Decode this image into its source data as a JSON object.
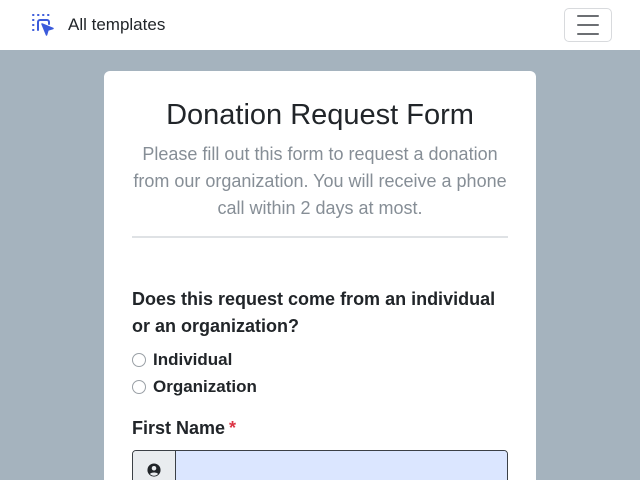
{
  "navbar": {
    "brand_label": "All templates",
    "brand_icon": "cursor-select-icon",
    "menu_icon": "hamburger-menu-icon"
  },
  "form": {
    "title": "Donation Request Form",
    "description": "Please fill out this form to request a donation from our organization. You will receive a phone call within 2 days at most.",
    "question": "Does this request come from an individual or an organization?",
    "options": [
      {
        "label": "Individual",
        "checked": false
      },
      {
        "label": "Organization",
        "checked": false
      }
    ],
    "first_name": {
      "label": "First Name",
      "required_marker": "*",
      "value": "",
      "icon": "user-circle-icon"
    }
  },
  "colors": {
    "page_background": "#a5b3be",
    "brand_icon": "#3b5bdb",
    "required": "#dc3545",
    "input_fill": "#dbe6ff"
  }
}
